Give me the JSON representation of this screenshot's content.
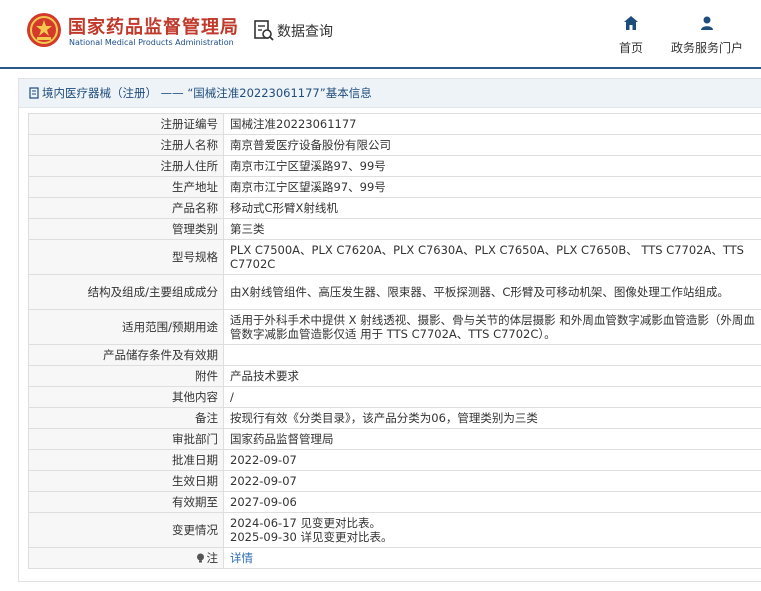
{
  "header": {
    "title": "国家药品监督管理局",
    "subtitle": "National Medical Products Administration",
    "query_label": "数据查询",
    "nav": [
      {
        "label": "首页",
        "icon": "home-icon"
      },
      {
        "label": "政务服务门户",
        "icon": "user-icon"
      }
    ]
  },
  "colors": {
    "brand_red": "#c0392b",
    "brand_blue": "#1e4c7c",
    "link": "#2b6cb0"
  },
  "breadcrumb": {
    "section": "境内医疗器械（注册）",
    "separator": "——",
    "current": "“国械注准20223061177”基本信息"
  },
  "rows": [
    {
      "label": "注册证编号",
      "value": "国械注准20223061177"
    },
    {
      "label": "注册人名称",
      "value": "南京普爱医疗设备股份有限公司"
    },
    {
      "label": "注册人住所",
      "value": "南京市江宁区望溪路97、99号"
    },
    {
      "label": "生产地址",
      "value": "南京市江宁区望溪路97、99号"
    },
    {
      "label": "产品名称",
      "value": "移动式C形臂X射线机"
    },
    {
      "label": "管理类别",
      "value": "第三类"
    },
    {
      "label": "型号规格",
      "value": "PLX C7500A、PLX C7620A、PLX C7630A、PLX C7650A、PLX C7650B、 TTS C7702A、TTS C7702C"
    },
    {
      "label": "结构及组成/主要组成成分",
      "value": "由X射线管组件、高压发生器、限束器、平板探测器、C形臂及可移动机架、图像处理工作站组成。"
    },
    {
      "label": "适用范围/预期用途",
      "value": "适用于外科手术中提供 X 射线透视、摄影、骨与关节的体层摄影 和外周血管数字减影血管造影（外周血管数字减影血管造影仅适 用于 TTS C7702A、TTS C7702C）。"
    },
    {
      "label": "产品储存条件及有效期",
      "value": ""
    },
    {
      "label": "附件",
      "value": "产品技术要求"
    },
    {
      "label": "其他内容",
      "value": "/"
    },
    {
      "label": "备注",
      "value": "按现行有效《分类目录》，该产品分类为06，管理类别为三类"
    },
    {
      "label": "审批部门",
      "value": "国家药品监督管理局"
    },
    {
      "label": "批准日期",
      "value": "2022-09-07"
    },
    {
      "label": "生效日期",
      "value": "2022-09-07"
    },
    {
      "label": "有效期至",
      "value": "2027-09-06"
    },
    {
      "label": "变更情况",
      "value": "2024-06-17 见变更对比表。\n2025-09-30 详见变更对比表。"
    },
    {
      "label": "注",
      "value": "详情"
    }
  ]
}
